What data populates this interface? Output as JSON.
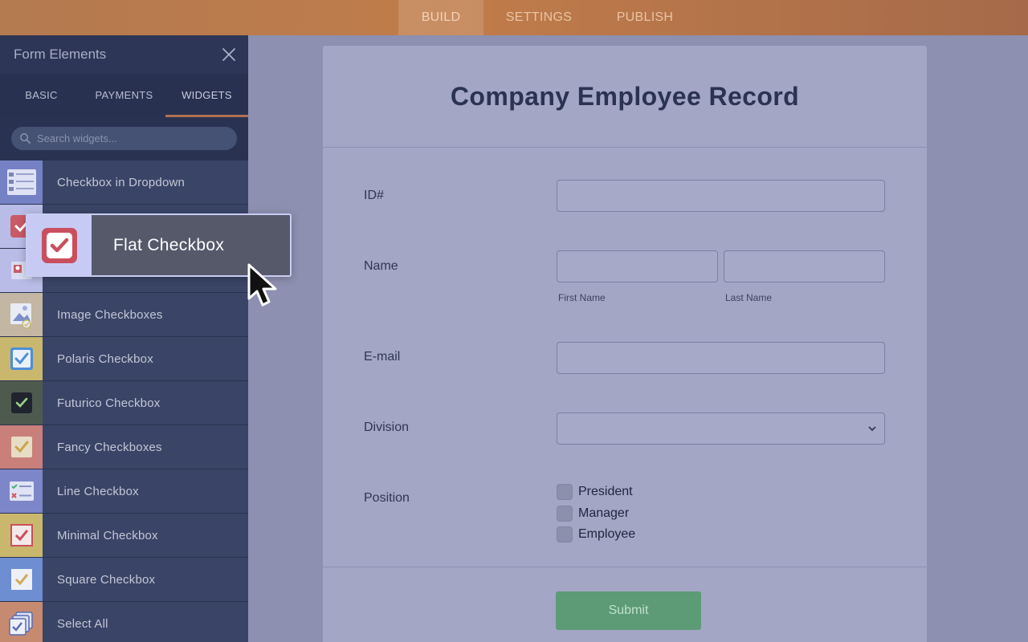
{
  "topnav": {
    "tabs": [
      "BUILD",
      "SETTINGS",
      "PUBLISH"
    ],
    "active": "BUILD"
  },
  "sidebar": {
    "title": "Form Elements",
    "tabs": [
      "BASIC",
      "PAYMENTS",
      "WIDGETS"
    ],
    "active_tab": "WIDGETS",
    "search_placeholder": "Search widgets...",
    "items": [
      {
        "label": "Checkbox in Dropdown",
        "icon": "checkbox-dropdown-icon",
        "color": "#7481c4"
      },
      {
        "label": "",
        "icon": "flat-checkbox-icon",
        "color": "#b9bce6"
      },
      {
        "label": "",
        "icon": "person-checkbox-icon",
        "color": "#b9bce6"
      },
      {
        "label": "Image Checkboxes",
        "icon": "image-checkbox-icon",
        "color": "#c3b6a2"
      },
      {
        "label": "Polaris Checkbox",
        "icon": "polaris-checkbox-icon",
        "color": "#c9b76e"
      },
      {
        "label": "Futurico Checkbox",
        "icon": "futurico-checkbox-icon",
        "color": "#4e5a4e"
      },
      {
        "label": "Fancy Checkboxes",
        "icon": "fancy-checkbox-icon",
        "color": "#c9807a"
      },
      {
        "label": "Line Checkbox",
        "icon": "line-checkbox-icon",
        "color": "#7c86c9"
      },
      {
        "label": "Minimal Checkbox",
        "icon": "minimal-checkbox-icon",
        "color": "#c9b76e"
      },
      {
        "label": "Square Checkbox",
        "icon": "square-checkbox-icon",
        "color": "#6d8ed0"
      },
      {
        "label": "Select All",
        "icon": "select-all-icon",
        "color": "#c58a6f"
      }
    ]
  },
  "dragging": {
    "label": "Flat Checkbox",
    "icon": "flat-checkbox-icon"
  },
  "form": {
    "title": "Company Employee Record",
    "fields": {
      "id": {
        "label": "ID#",
        "value": ""
      },
      "name": {
        "label": "Name",
        "first_sublabel": "First Name",
        "last_sublabel": "Last Name",
        "first_value": "",
        "last_value": ""
      },
      "email": {
        "label": "E-mail",
        "value": ""
      },
      "division": {
        "label": "Division",
        "value": ""
      },
      "position": {
        "label": "Position",
        "options": [
          "President",
          "Manager",
          "Employee"
        ]
      }
    },
    "submit_label": "Submit"
  },
  "colors": {
    "topbar": "#c07c4a",
    "sidebar": "#30395a",
    "accent": "#b27150",
    "submit": "#5d9b76",
    "card": "#a3a6c5"
  }
}
